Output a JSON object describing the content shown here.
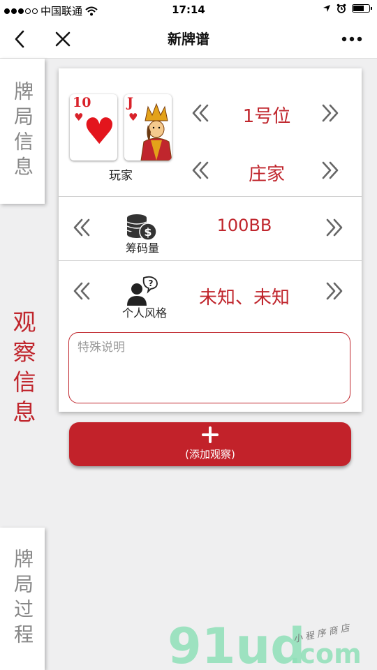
{
  "status_bar": {
    "carrier": "中国联通",
    "time": "17:14"
  },
  "nav": {
    "title": "新牌谱"
  },
  "sidebar": {
    "info_tab": "牌局信息",
    "observation_tab": "观察信息",
    "process_tab": "牌局过程"
  },
  "player_row": {
    "cards": [
      {
        "rank": "10",
        "suit": "hearts"
      },
      {
        "rank": "J",
        "suit": "hearts"
      }
    ],
    "label": "玩家",
    "position": "1号位",
    "role": "庄家"
  },
  "chips_row": {
    "label": "筹码量",
    "value": "100BB"
  },
  "style_row": {
    "label": "个人风格",
    "value": "未知、未知"
  },
  "note": {
    "placeholder": "特殊说明"
  },
  "add_button": {
    "label": "(添加观察)"
  },
  "watermark": {
    "brand": "91ud.com",
    "tagline": "小程序商店"
  },
  "colors": {
    "accent": "#c2222a",
    "text_red": "#c0262d"
  },
  "icons": [
    "back-icon",
    "close-icon",
    "more-icon",
    "chevron-left-icon",
    "chevron-right-icon",
    "chips-icon",
    "person-question-icon",
    "plus-icon"
  ]
}
